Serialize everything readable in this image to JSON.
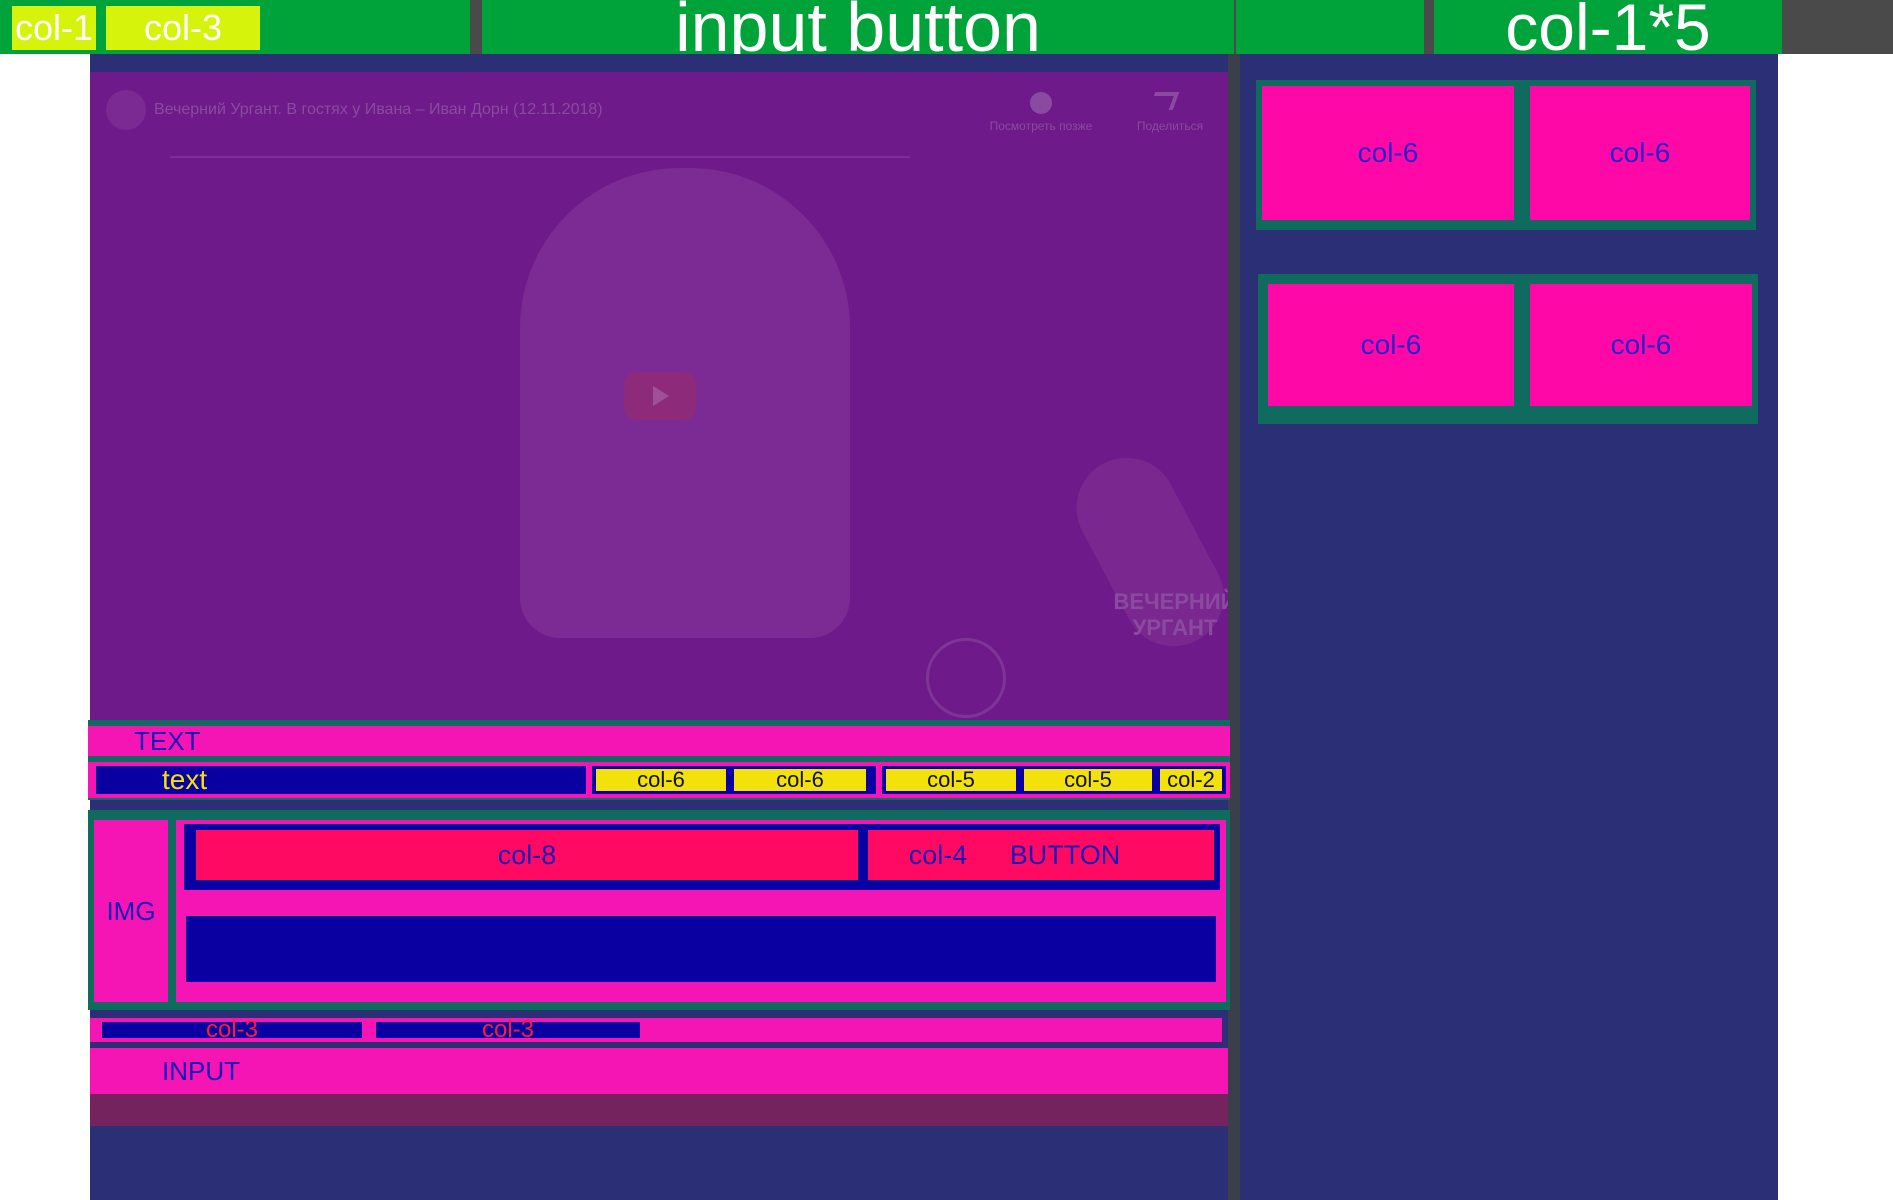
{
  "header": {
    "col_1": "col-1",
    "col_3": "col-3",
    "input_button": "input button",
    "col_1x5": "col-1*5"
  },
  "video": {
    "title": "Вечерний Ургант. В гостях у Ивана – Иван Дорн (12.11.2018)",
    "watch_later": "Посмотреть позже",
    "share": "Поделиться",
    "logo_text": "ВЕЧЕРНИЙ УРГАНТ"
  },
  "info": {
    "text_upper": "TEXT",
    "text_lower": "text",
    "cols": [
      "col-6",
      "col-6",
      "col-5",
      "col-5",
      "col-2"
    ]
  },
  "comment": {
    "img": "IMG",
    "col_8": "col-8",
    "col_4": "col-4",
    "button": "BUTTON"
  },
  "bottom": {
    "col_3_a": "col-3",
    "col_3_b": "col-3",
    "input": "INPUT"
  },
  "sidebar": {
    "tiles": [
      "col-6",
      "col-6",
      "col-6",
      "col-6"
    ]
  },
  "colors": {
    "green": "#00a23a",
    "lime": "#d6f30c",
    "navy": "#2a2f76",
    "purple": "#6f1a8a",
    "pink": "#f514b4",
    "dark_blue": "#0a00a2",
    "yellow": "#f2e10b",
    "red": "#ff0a63",
    "teal": "#0f6b5e"
  }
}
